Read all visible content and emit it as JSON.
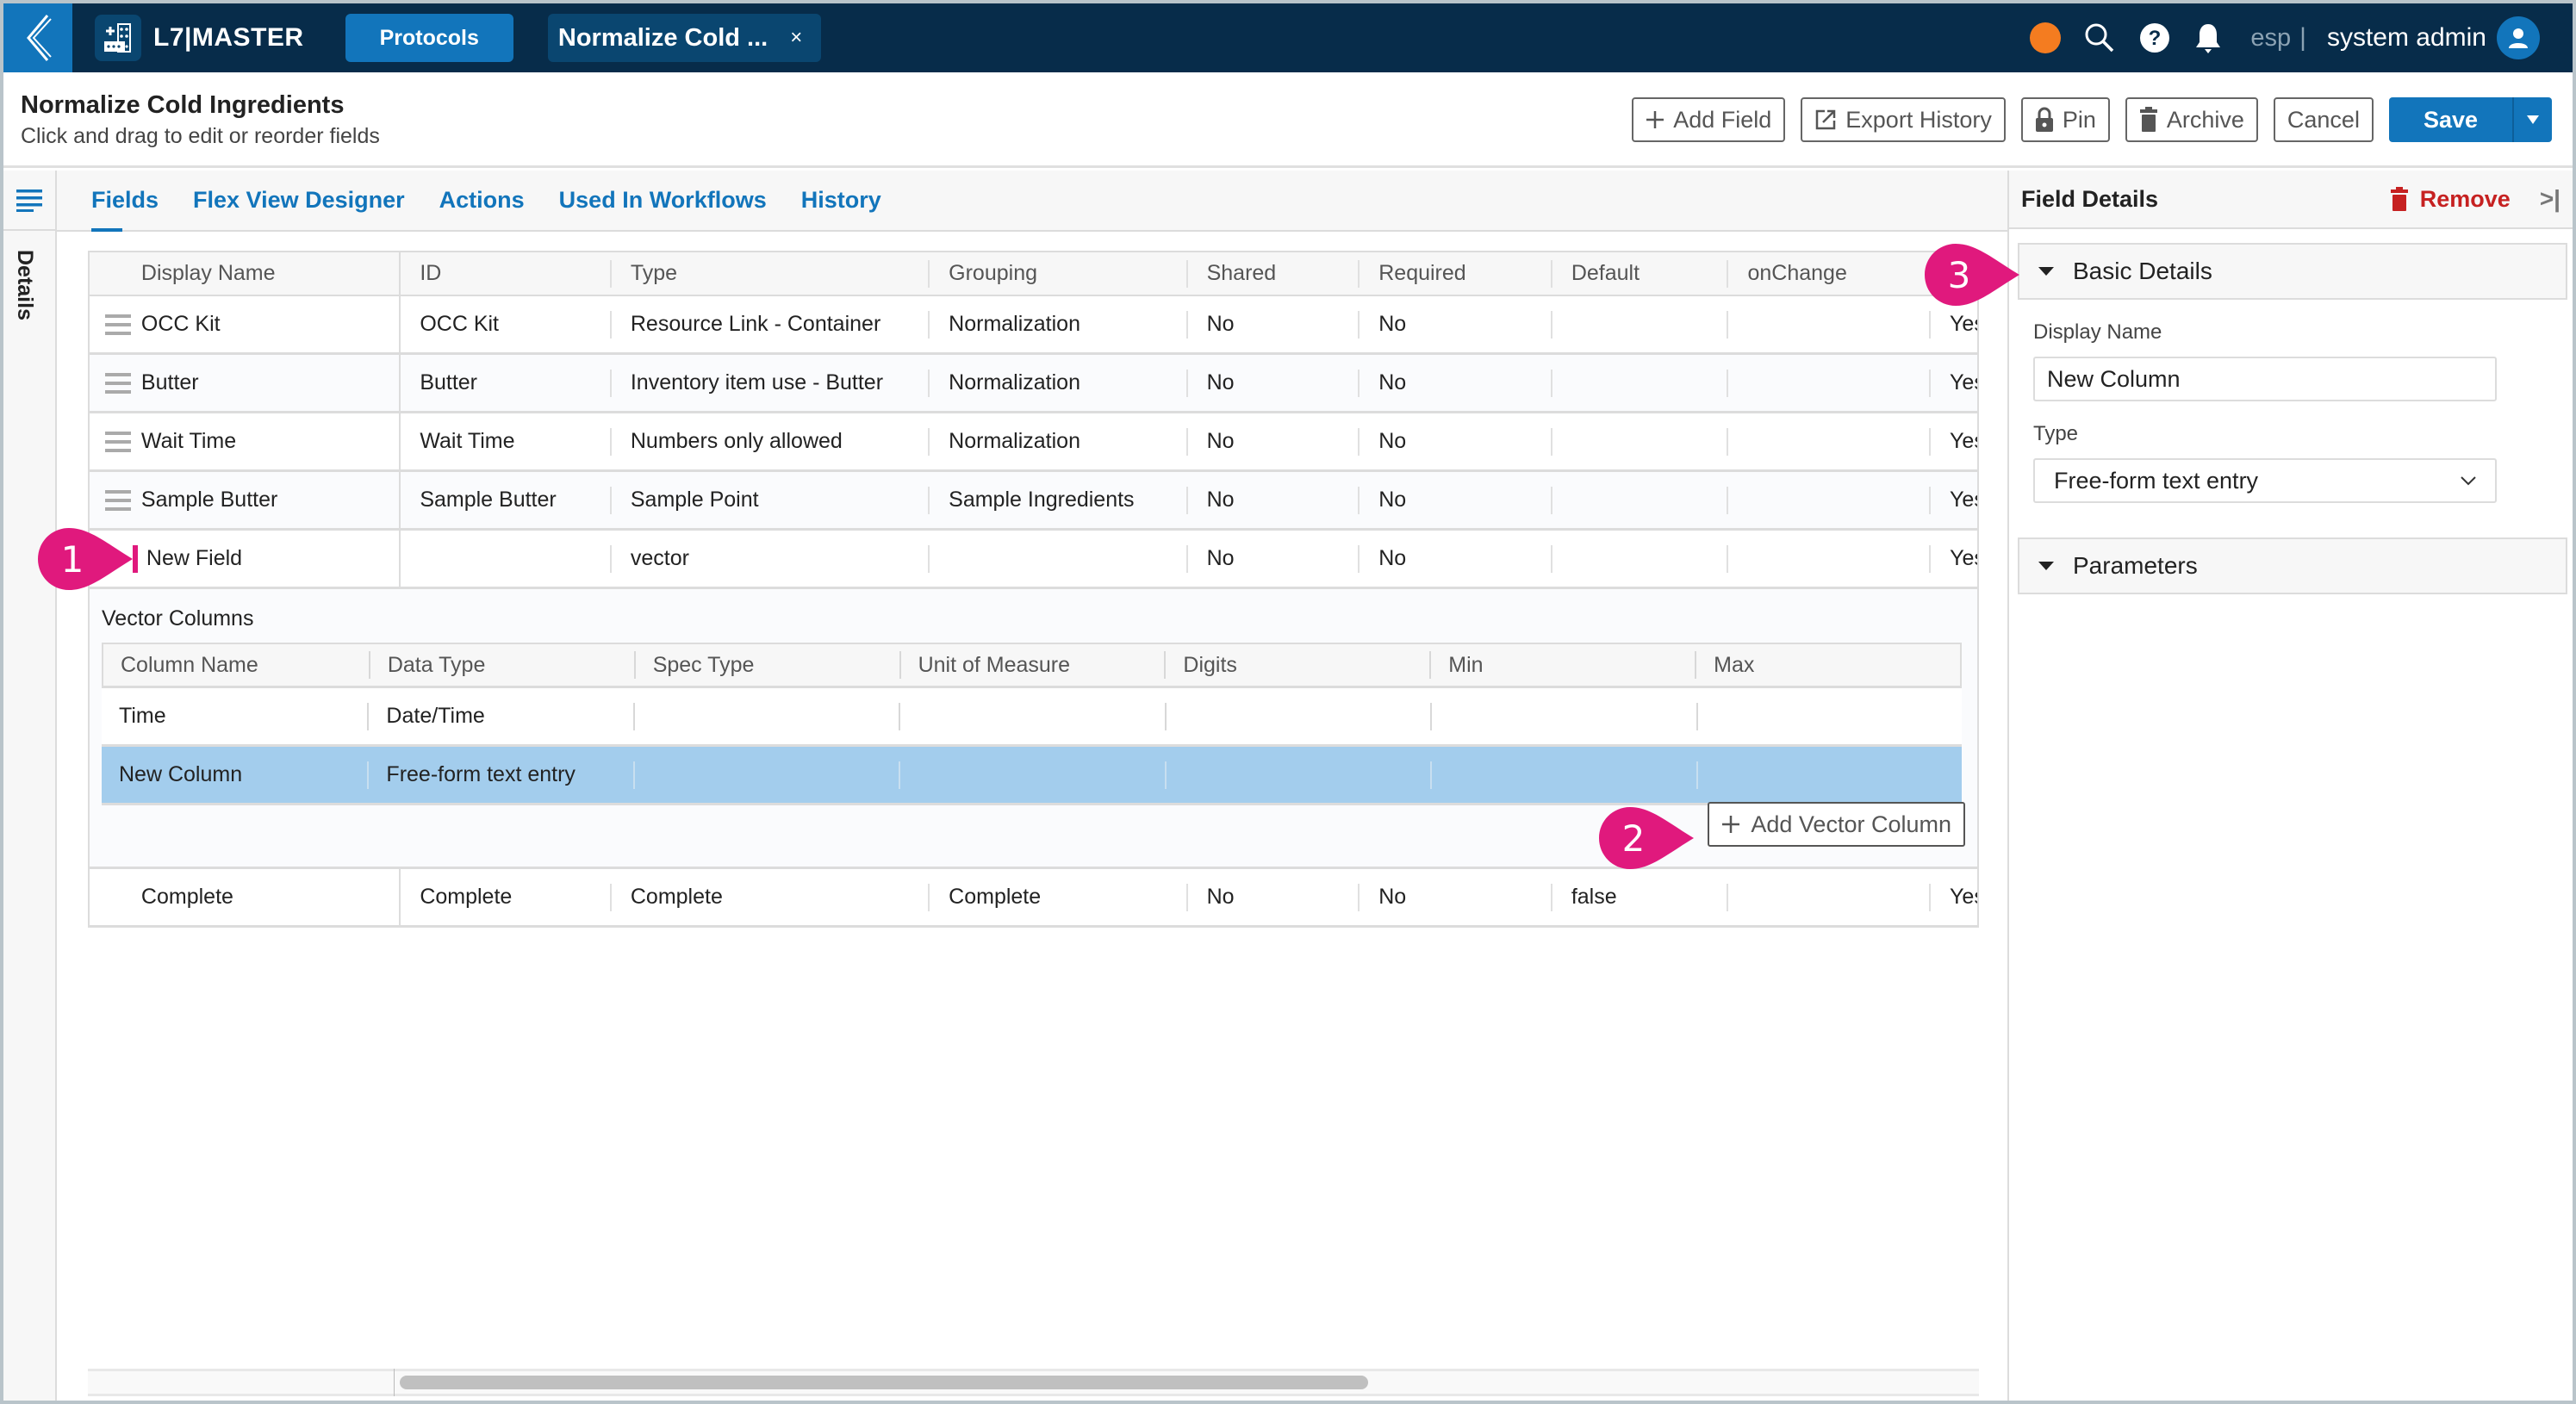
{
  "navbar": {
    "back_icon": "chevron-left-icon",
    "brand": "L7|MASTER",
    "protocols_tab": "Protocols",
    "doc_tab": "Normalize Cold ...",
    "doc_tab_close": "×",
    "status_color": "#f47c20",
    "language": "esp",
    "separator": "|",
    "user": "system admin"
  },
  "header": {
    "title": "Normalize Cold Ingredients",
    "subtitle": "Click and drag to edit or reorder fields",
    "buttons": {
      "add_field": "Add Field",
      "export_history": "Export History",
      "pin": "Pin",
      "archive": "Archive",
      "cancel": "Cancel",
      "save": "Save"
    }
  },
  "left_rail": {
    "details_label": "Details"
  },
  "tabs": [
    {
      "label": "Fields",
      "active": true
    },
    {
      "label": "Flex View Designer",
      "active": false
    },
    {
      "label": "Actions",
      "active": false
    },
    {
      "label": "Used In Workflows",
      "active": false
    },
    {
      "label": "History",
      "active": false
    }
  ],
  "fields_table": {
    "columns": [
      "Display Name",
      "ID",
      "Type",
      "Grouping",
      "Shared",
      "Required",
      "Default",
      "onChange",
      ""
    ],
    "rows": [
      {
        "display_name": "OCC Kit",
        "id": "OCC Kit",
        "type": "Resource Link - Container",
        "grouping": "Normalization",
        "shared": "No",
        "required": "No",
        "default": "",
        "onchange": "",
        "last": "Yes"
      },
      {
        "display_name": "Butter",
        "id": "Butter",
        "type": "Inventory item use - Butter",
        "grouping": "Normalization",
        "shared": "No",
        "required": "No",
        "default": "",
        "onchange": "",
        "last": "Yes"
      },
      {
        "display_name": "Wait Time",
        "id": "Wait Time",
        "type": "Numbers only allowed",
        "grouping": "Normalization",
        "shared": "No",
        "required": "No",
        "default": "",
        "onchange": "",
        "last": "Yes"
      },
      {
        "display_name": "Sample Butter",
        "id": "Sample Butter",
        "type": "Sample Point",
        "grouping": "Sample Ingredients",
        "shared": "No",
        "required": "No",
        "default": "",
        "onchange": "",
        "last": "Yes"
      },
      {
        "display_name": "New Field",
        "id": "",
        "type": "vector",
        "grouping": "",
        "shared": "No",
        "required": "No",
        "default": "",
        "onchange": "",
        "last": "Yes",
        "expanded": true
      },
      {
        "display_name": "Complete",
        "id": "Complete",
        "type": "Complete",
        "grouping": "Complete",
        "shared": "No",
        "required": "No",
        "default": "false",
        "onchange": "",
        "last": "Yes"
      }
    ]
  },
  "vector_columns": {
    "title": "Vector Columns",
    "columns": [
      "Column Name",
      "Data Type",
      "Spec Type",
      "Unit of Measure",
      "Digits",
      "Min",
      "Max"
    ],
    "rows": [
      {
        "cells": [
          "Time",
          "Date/Time",
          "",
          "",
          "",
          "",
          ""
        ],
        "selected": false
      },
      {
        "cells": [
          "New Column",
          "Free-form text entry",
          "",
          "",
          "",
          "",
          ""
        ],
        "selected": true
      }
    ],
    "add_button": "Add Vector Column"
  },
  "field_details": {
    "title": "Field Details",
    "remove": "Remove",
    "collapse": ">|",
    "basic_details": "Basic Details",
    "display_name_label": "Display Name",
    "display_name_value": "New Column",
    "type_label": "Type",
    "type_value": "Free-form text entry",
    "parameters": "Parameters"
  },
  "callouts": [
    "1",
    "2",
    "3"
  ],
  "colors": {
    "navbar": "#072c4a",
    "accent": "#1275bb",
    "callout": "#e0197d",
    "remove": "#c62121",
    "selected_row": "#a3cded"
  }
}
